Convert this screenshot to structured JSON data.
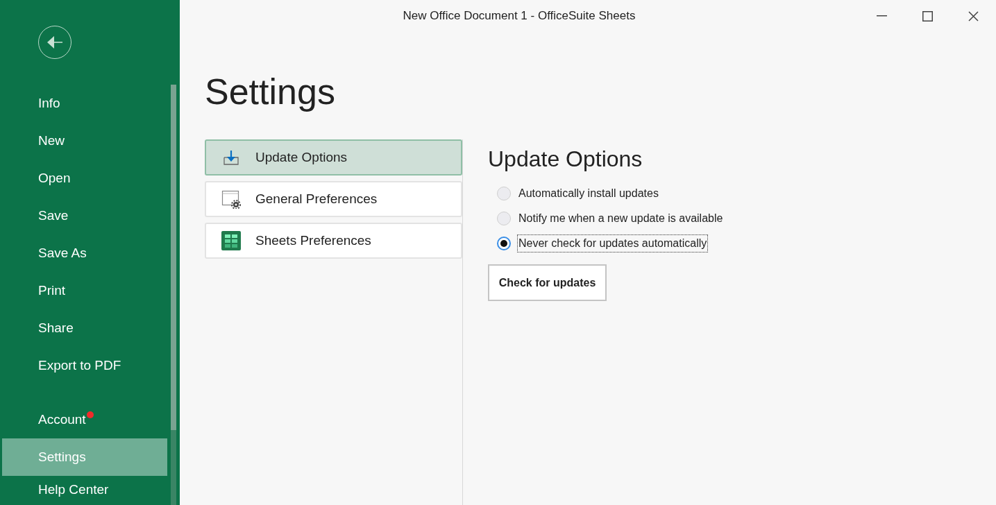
{
  "window": {
    "title": "New Office Document 1 - OfficeSuite Sheets"
  },
  "sidebar": {
    "items": [
      {
        "label": "Info",
        "selected": false,
        "notification": false
      },
      {
        "label": "New",
        "selected": false,
        "notification": false
      },
      {
        "label": "Open",
        "selected": false,
        "notification": false
      },
      {
        "label": "Save",
        "selected": false,
        "notification": false
      },
      {
        "label": "Save As",
        "selected": false,
        "notification": false
      },
      {
        "label": "Print",
        "selected": false,
        "notification": false
      },
      {
        "label": "Share",
        "selected": false,
        "notification": false
      },
      {
        "label": "Export to PDF",
        "selected": false,
        "notification": false
      }
    ],
    "bottom_items": [
      {
        "label": "Account",
        "selected": false,
        "notification": true
      },
      {
        "label": "Settings",
        "selected": true,
        "notification": false
      },
      {
        "label": "Help Center",
        "selected": false,
        "notification": false
      }
    ]
  },
  "page_title": "Settings",
  "categories": [
    {
      "label": "Update Options",
      "kind": "download",
      "selected": true
    },
    {
      "label": "General Preferences",
      "kind": "preferences",
      "selected": false
    },
    {
      "label": "Sheets Preferences",
      "kind": "sheets",
      "selected": false
    }
  ],
  "panel": {
    "title": "Update Options",
    "options": [
      {
        "label": "Automatically install updates",
        "selected": false
      },
      {
        "label": "Notify me when a new update is available",
        "selected": false
      },
      {
        "label": "Never check for updates automatically",
        "selected": true
      }
    ],
    "button": "Check for updates"
  }
}
